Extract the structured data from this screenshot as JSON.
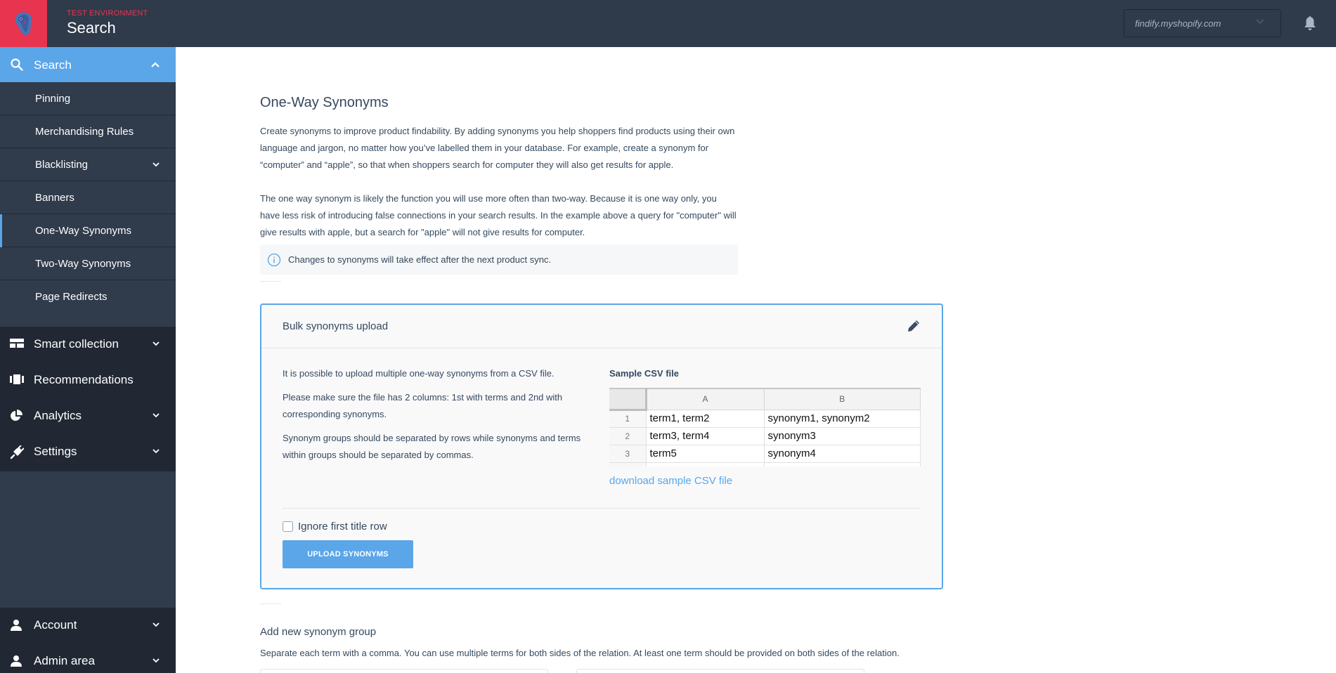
{
  "topbar": {
    "environment_label": "TEST ENVIRONMENT",
    "app_title": "Search",
    "store_selector": {
      "value": "findify.myshopify.com"
    },
    "logo_icon": "owl-logo",
    "notifications_icon": "bell-icon"
  },
  "sidebar": {
    "search_section": {
      "label": "Search",
      "icon": "search-icon",
      "expanded": true
    },
    "sub_items": [
      {
        "label": "Pinning"
      },
      {
        "label": "Merchandising Rules"
      },
      {
        "label": "Blacklisting",
        "has_submenu": true
      },
      {
        "label": "Banners"
      },
      {
        "label": "One-Way Synonyms",
        "active": true
      },
      {
        "label": "Two-Way Synonyms"
      },
      {
        "label": "Page Redirects"
      }
    ],
    "main_items": [
      {
        "label": "Smart collection",
        "icon": "layout-icon",
        "has_submenu": true
      },
      {
        "label": "Recommendations",
        "icon": "columns-icon",
        "has_submenu": false
      },
      {
        "label": "Analytics",
        "icon": "pie-chart-icon",
        "has_submenu": true
      },
      {
        "label": "Settings",
        "icon": "plug-icon",
        "has_submenu": true
      }
    ],
    "bottom_items": [
      {
        "label": "Account",
        "icon": "user-icon"
      },
      {
        "label": "Admin area",
        "icon": "user-icon"
      }
    ]
  },
  "main": {
    "title": "One-Way Synonyms",
    "paragraphs": [
      "Create synonyms to improve product findability. By adding synonyms you help shoppers find products using their own language and jargon, no matter how you’ve labelled them in your database. For example, create a synonym for “computer” and “apple”, so that when shoppers search for computer they will also get results for apple.",
      "The one way synonym is likely the function you will use more often than two-way. Because it is one way only, you have less risk of introducing false connections in your search results. In the example above a query for \"computer\" will give results with apple, but a search for \"apple\" will not give results for computer."
    ],
    "info_notice": "Changes to synonyms will take effect after the next product sync.",
    "bulk_upload": {
      "title": "Bulk synonyms upload",
      "texts": [
        "It is possible to upload multiple one-way synonyms from a CSV file.",
        "Please make sure the file has 2 columns: 1st with terms and 2nd with corresponding synonyms.",
        "Synonym groups should be separated by rows while synonyms and terms within groups should be separated by commas."
      ],
      "sample_label": "Sample CSV file",
      "sample_table": {
        "columns": [
          "A",
          "B"
        ],
        "rows": [
          {
            "num": "1",
            "a": "term1, term2",
            "b": "synonym1, synonym2"
          },
          {
            "num": "2",
            "a": "term3, term4",
            "b": "synonym3"
          },
          {
            "num": "3",
            "a": "term5",
            "b": "synonym4"
          }
        ]
      },
      "download_link": "download sample CSV file",
      "ignore_checkbox": {
        "label": "Ignore first title row",
        "checked": false
      },
      "upload_button": "UPLOAD SYNONYMS"
    },
    "add_group": {
      "title": "Add new synonym group",
      "description": "Separate each term with a comma. You can use multiple terms for both sides of the relation. At least one term should be provided on both sides of the relation."
    }
  },
  "colors": {
    "accent": "#5aa6e8",
    "brand_red": "#e8344f",
    "topbar": "#2f3a4a",
    "sidebar": "#303b4b",
    "sidebar_dark": "#212833"
  }
}
